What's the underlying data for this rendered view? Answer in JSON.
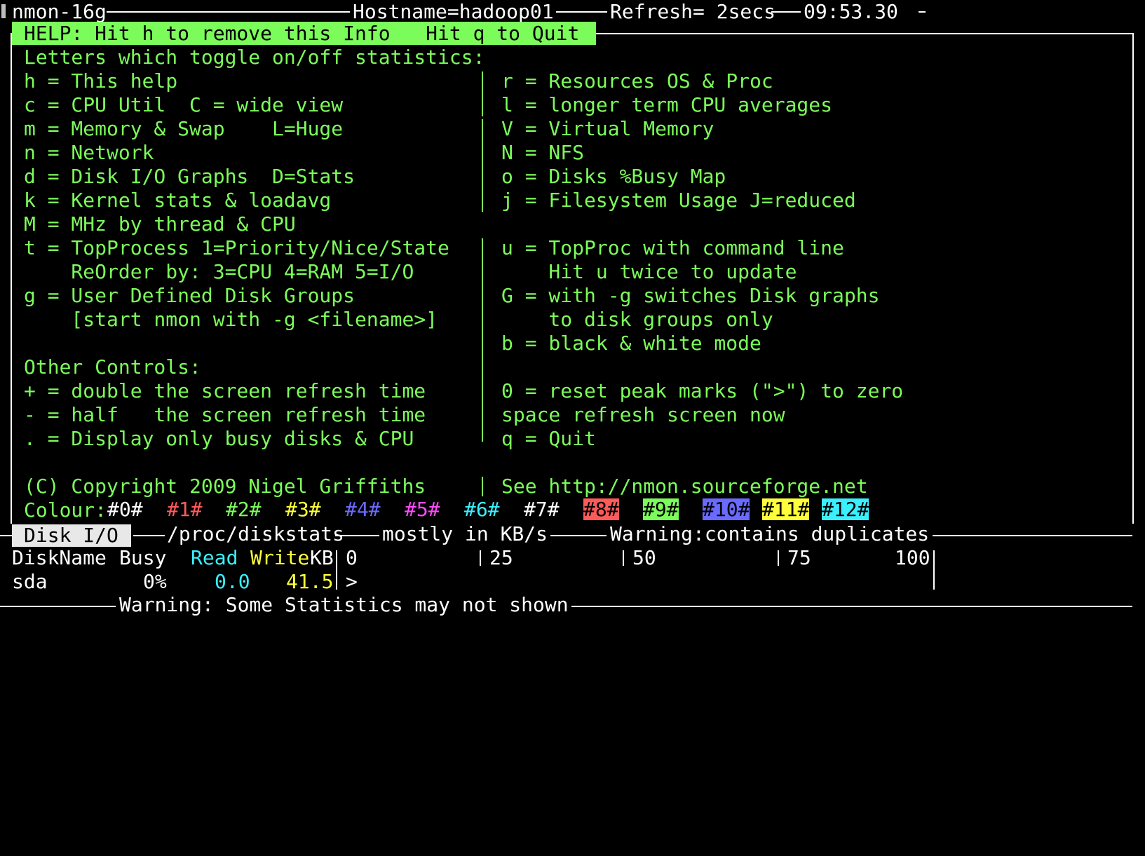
{
  "colors": {
    "green": "#7cfc5a",
    "white": "#ffffff",
    "background": "#000000",
    "tab_bg": "#e8e8e8"
  },
  "header": {
    "title": "nmon-16g",
    "hostname": "Hostname=hadoop01",
    "refresh": "Refresh= 2secs",
    "time": "09:53.30"
  },
  "help": {
    "bar_text": "HELP: Hit h to remove this Info   Hit q to Quit",
    "toggles_heading": "Letters which toggle on/off statistics:",
    "left": [
      "h = This help",
      "c = CPU Util  C = wide view",
      "m = Memory & Swap    L=Huge",
      "n = Network",
      "d = Disk I/O Graphs  D=Stats",
      "k = Kernel stats & loadavg",
      "M = MHz by thread & CPU",
      "t = TopProcess 1=Priority/Nice/State",
      "    ReOrder by: 3=CPU 4=RAM 5=I/O",
      "g = User Defined Disk Groups",
      "    [start nmon with -g <filename>]",
      ""
    ],
    "right": [
      "r = Resources OS & Proc",
      "l = longer term CPU averages",
      "V = Virtual Memory",
      "N = NFS",
      "o = Disks %Busy Map",
      "j = Filesystem Usage J=reduced",
      "",
      "u = TopProc with command line",
      "    Hit u twice to update",
      "G = with -g switches Disk graphs",
      "    to disk groups only",
      "b = black & white mode"
    ],
    "other_heading": "Other Controls:",
    "other_left": [
      "+ = double the screen refresh time",
      "- = half   the screen refresh time",
      ". = Display only busy disks & CPU"
    ],
    "other_right": [
      "0 = reset peak marks (\">\") to zero",
      "space refresh screen now",
      "q = Quit"
    ],
    "copyright": "(C) Copyright 2009 Nigel Griffiths",
    "see_url": "See http://nmon.sourceforge.net",
    "colour_label": "Colour:",
    "colour_samples": [
      {
        "text": "#0#",
        "fg": "#ffffff",
        "bg": ""
      },
      {
        "text": "#1#",
        "fg": "#ff5a5a",
        "bg": ""
      },
      {
        "text": "#2#",
        "fg": "#7cfc5a",
        "bg": ""
      },
      {
        "text": "#3#",
        "fg": "#ffff3a",
        "bg": ""
      },
      {
        "text": "#4#",
        "fg": "#6a6aff",
        "bg": ""
      },
      {
        "text": "#5#",
        "fg": "#ff4aff",
        "bg": ""
      },
      {
        "text": "#6#",
        "fg": "#3af0ff",
        "bg": ""
      },
      {
        "text": "#7#",
        "fg": "#ffffff",
        "bg": ""
      },
      {
        "text": "#8#",
        "fg": "#000000",
        "bg": "#ff5a5a"
      },
      {
        "text": "#9#",
        "fg": "#000000",
        "bg": "#7cfc5a"
      },
      {
        "text": "#10#",
        "fg": "#000000",
        "bg": "#6a6aff"
      },
      {
        "text": "#11#",
        "fg": "#000000",
        "bg": "#ffff3a"
      },
      {
        "text": "#12#",
        "fg": "#000000",
        "bg": "#3af0ff"
      }
    ]
  },
  "disk": {
    "tab_label": "Disk I/O",
    "source": "/proc/diskstats",
    "units": "mostly in KB/s",
    "warning": "Warning:contains duplicates",
    "col_name": "DiskName",
    "col_busy": "Busy",
    "col_read": "Read",
    "col_write": "Write",
    "col_kb": "KB",
    "scale": [
      "0",
      "25",
      "50",
      "75",
      "100"
    ],
    "rows": [
      {
        "name": "sda",
        "busy": "0%",
        "read": "0.0",
        "write": "41.5",
        "graph": ">"
      }
    ],
    "footer_warning": "Warning: Some Statistics may not shown"
  }
}
